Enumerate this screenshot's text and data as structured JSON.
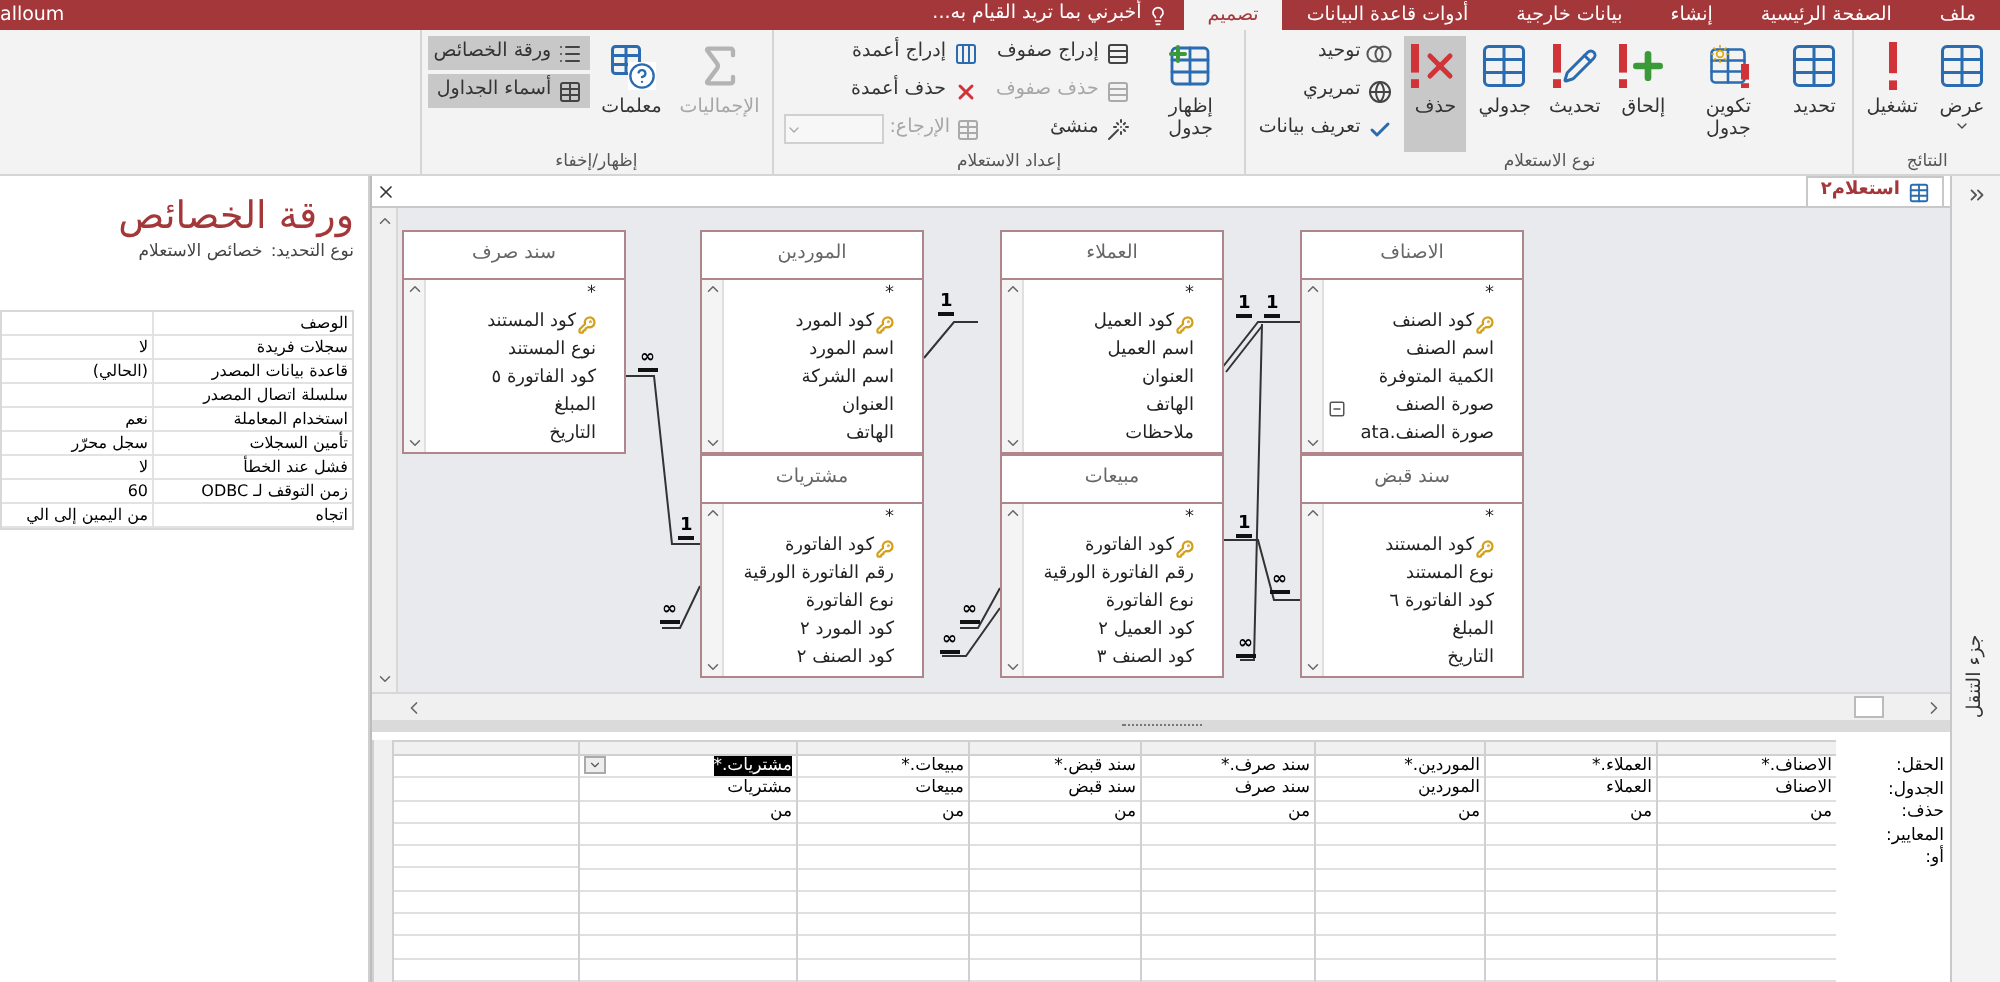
{
  "title_bar": {
    "user": "alloum",
    "tell_me": "أخبرني بما تريد القيام به..."
  },
  "menu_tabs": [
    {
      "label": "ملف",
      "selected": false
    },
    {
      "label": "الصفحة الرئيسية",
      "selected": false
    },
    {
      "label": "إنشاء",
      "selected": false
    },
    {
      "label": "بيانات خارجية",
      "selected": false
    },
    {
      "label": "أدوات قاعدة البيانات",
      "selected": false
    },
    {
      "label": "تصميم",
      "selected": true
    }
  ],
  "ribbon": [
    {
      "label": "النتائج",
      "items": [
        {
          "kind": "large",
          "label": "عرض",
          "selected": false,
          "disabled": false,
          "dropdown": true
        },
        {
          "kind": "large",
          "label": "تشغيل",
          "selected": false,
          "disabled": false,
          "dropdown": false
        }
      ]
    },
    {
      "label": "نوع الاستعلام",
      "items": [
        {
          "kind": "large",
          "label": "تحديد",
          "selected": false,
          "disabled": false,
          "dropdown": false
        },
        {
          "kind": "large",
          "label": "تكوين جدول",
          "selected": false,
          "disabled": false,
          "dropdown": false
        },
        {
          "kind": "large",
          "label": "إلحاق",
          "selected": false,
          "disabled": false,
          "dropdown": false
        },
        {
          "kind": "large",
          "label": "تحديث",
          "selected": false,
          "disabled": false,
          "dropdown": false
        },
        {
          "kind": "large",
          "label": "جدولي",
          "selected": false,
          "disabled": false,
          "dropdown": false
        },
        {
          "kind": "large",
          "label": "حذف",
          "selected": true,
          "disabled": false,
          "dropdown": false
        },
        {
          "kind": "column",
          "items": [
            {
              "kind": "small",
              "label": "توحيد",
              "selected": false,
              "disabled": false
            },
            {
              "kind": "small",
              "label": "تمريري",
              "selected": false,
              "disabled": false
            },
            {
              "kind": "small",
              "label": "تعريف بيانات",
              "selected": false,
              "disabled": false
            }
          ]
        }
      ]
    },
    {
      "label": "إعداد الاستعلام",
      "items": [
        {
          "kind": "large",
          "label": "إظهار جدول",
          "selected": false,
          "disabled": false,
          "dropdown": false
        },
        {
          "kind": "column",
          "items": [
            {
              "kind": "small",
              "label": "إدراج صفوف",
              "selected": false,
              "disabled": false
            },
            {
              "kind": "small",
              "label": "حذف صفوف",
              "selected": false,
              "disabled": true
            },
            {
              "kind": "small",
              "label": "منشئ",
              "selected": false,
              "disabled": false
            }
          ]
        },
        {
          "kind": "column",
          "items": [
            {
              "kind": "small",
              "label": "إدراج أعمدة",
              "selected": false,
              "disabled": false
            },
            {
              "kind": "small",
              "label": "حذف أعمدة",
              "selected": false,
              "disabled": false
            },
            {
              "kind": "combo",
              "label": "الإرجاع:",
              "selected": false,
              "disabled": true
            }
          ]
        }
      ]
    },
    {
      "label": "إظهار/إخفاء",
      "items": [
        {
          "kind": "large",
          "label": "الإجماليات",
          "selected": false,
          "disabled": true,
          "dropdown": false
        },
        {
          "kind": "large",
          "label": "معلمات",
          "selected": false,
          "disabled": false,
          "dropdown": false
        },
        {
          "kind": "column",
          "items": [
            {
              "kind": "small",
              "label": "ورقة الخصائص",
              "selected": true,
              "disabled": false
            },
            {
              "kind": "small",
              "label": "أسماء الجداول",
              "selected": true,
              "disabled": false
            }
          ]
        }
      ]
    }
  ],
  "property_sheet": {
    "title": "ورقة الخصائص",
    "selection_label": "نوع التحديد:",
    "selection_value": "خصائص الاستعلام",
    "rows": [
      {
        "label": "الوصف"
      },
      {
        "label": "سجلات فريدة",
        "value": "لا"
      },
      {
        "label": "قاعدة بيانات المصدر",
        "value": "(الحالي)"
      },
      {
        "label": "سلسلة اتصال المصدر"
      },
      {
        "label": "استخدام المعاملة",
        "value": "نعم"
      },
      {
        "label": "تأمين السجلات",
        "value": "سجل محرّر"
      },
      {
        "label": "فشل عند الخطأ",
        "value": "لا"
      },
      {
        "label": "زمن التوقف لـ ODBC",
        "value": "60"
      },
      {
        "label": "اتجاه",
        "value": "من اليمين إلى الي"
      }
    ]
  },
  "query_tab": {
    "label": "استعلام٢",
    "selected": true
  },
  "tables": [
    {
      "name": "الاصناف",
      "fields": [
        {
          "name": "*",
          "key": false
        },
        {
          "name": "كود الصنف",
          "key": true
        },
        {
          "name": "اسم الصنف",
          "key": false
        },
        {
          "name": "الكمية المتوفرة",
          "key": false
        },
        {
          "name": "صورة الصنف",
          "key": false,
          "expanded": true
        },
        {
          "name": "صورة الصنف.ata",
          "key": false
        }
      ]
    },
    {
      "name": "العملاء",
      "fields": [
        {
          "name": "*",
          "key": false
        },
        {
          "name": "كود العميل",
          "key": true
        },
        {
          "name": "اسم العميل",
          "key": false
        },
        {
          "name": "العنوان",
          "key": false
        },
        {
          "name": "الهاتف",
          "key": false
        },
        {
          "name": "ملاحظات",
          "key": false
        }
      ]
    },
    {
      "name": "الموردين",
      "fields": [
        {
          "name": "*",
          "key": false
        },
        {
          "name": "كود المورد",
          "key": true
        },
        {
          "name": "اسم المورد",
          "key": false
        },
        {
          "name": "اسم الشركة",
          "key": false
        },
        {
          "name": "العنوان",
          "key": false
        },
        {
          "name": "الهاتف",
          "key": false
        }
      ]
    },
    {
      "name": "سند صرف",
      "fields": [
        {
          "name": "*",
          "key": false
        },
        {
          "name": "كود المستند",
          "key": true
        },
        {
          "name": "نوع المستند",
          "key": false
        },
        {
          "name": "كود الفاتورة ٥",
          "key": false
        },
        {
          "name": "المبلغ",
          "key": false
        },
        {
          "name": "التاريخ",
          "key": false
        }
      ]
    },
    {
      "name": "سند قبض",
      "fields": [
        {
          "name": "*",
          "key": false
        },
        {
          "name": "كود المستند",
          "key": true
        },
        {
          "name": "نوع المستند",
          "key": false
        },
        {
          "name": "كود الفاتورة ٦",
          "key": false
        },
        {
          "name": "المبلغ",
          "key": false
        },
        {
          "name": "التاريخ",
          "key": false
        }
      ]
    },
    {
      "name": "مبيعات",
      "fields": [
        {
          "name": "*",
          "key": false
        },
        {
          "name": "كود الفاتورة",
          "key": true
        },
        {
          "name": "رقم الفاتورة الورقية",
          "key": false
        },
        {
          "name": "نوع الفاتورة",
          "key": false
        },
        {
          "name": "كود العميل ٢",
          "key": false
        },
        {
          "name": "كود الصنف ٣",
          "key": false
        }
      ]
    },
    {
      "name": "مشتريات",
      "fields": [
        {
          "name": "*",
          "key": false
        },
        {
          "name": "كود الفاتورة",
          "key": true
        },
        {
          "name": "رقم الفاتورة الورقية",
          "key": false
        },
        {
          "name": "نوع الفاتورة",
          "key": false
        },
        {
          "name": "كود المورد ٢",
          "key": false
        },
        {
          "name": "كود الصنف ٢",
          "key": false
        }
      ]
    }
  ],
  "relations": [
    {
      "ends": [
        "1",
        "1",
        "∞"
      ]
    },
    {
      "ends": [
        "1",
        "∞"
      ]
    },
    {
      "ends": [
        "∞"
      ]
    },
    {
      "ends": [
        "∞"
      ]
    },
    {
      "ends": [
        "1"
      ]
    },
    {
      "ends": [
        "∞"
      ]
    },
    {
      "ends": [
        "∞",
        "1"
      ]
    }
  ],
  "grid": {
    "row_labels": [
      "الحقل:",
      "الجدول:",
      "حذف:",
      "المعايير:",
      "أو:"
    ],
    "columns": [
      {
        "field": "الاصناف.*",
        "table": "الاصناف",
        "delete": "من",
        "selected": false
      },
      {
        "field": "العملاء.*",
        "table": "العملاء",
        "delete": "من",
        "selected": false
      },
      {
        "field": "الموردين.*",
        "table": "الموردين",
        "delete": "من",
        "selected": false
      },
      {
        "field": "سند صرف.*",
        "table": "سند صرف",
        "delete": "من",
        "selected": false
      },
      {
        "field": "سند قبض.*",
        "table": "سند قبض",
        "delete": "من",
        "selected": false
      },
      {
        "field": "مبيعات.*",
        "table": "مبيعات",
        "delete": "من",
        "selected": false
      },
      {
        "field": "مشتريات.*",
        "table": "مشتريات",
        "delete": "من",
        "selected": true
      }
    ]
  },
  "navigation_pane": {
    "label": "جزء التنقل",
    "collapsed": true
  }
}
